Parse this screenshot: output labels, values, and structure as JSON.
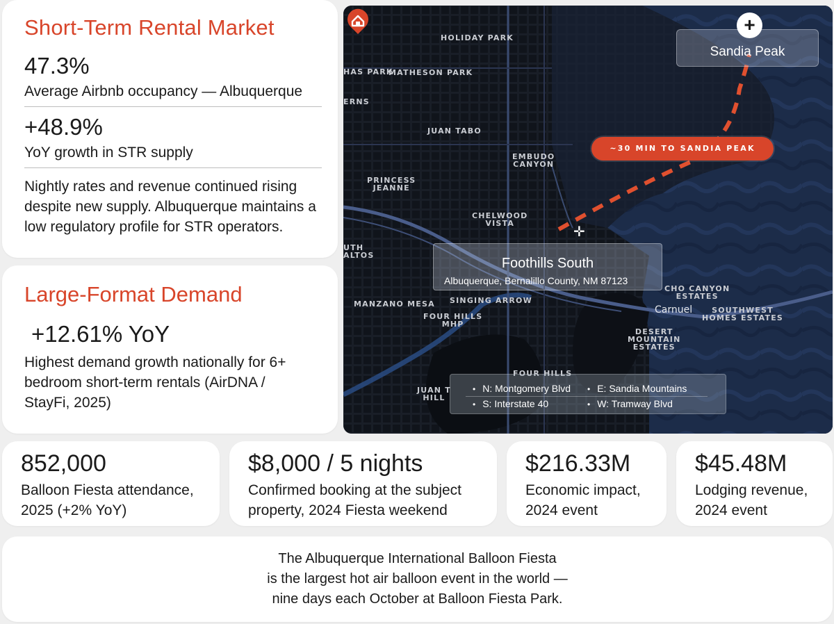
{
  "str_card": {
    "title": "Short-Term Rental Market",
    "occupancy_value": "47.3%",
    "occupancy_label": "Average Airbnb occupancy — Albuquerque",
    "supply_value": "+48.9%",
    "supply_label": "YoY growth in STR supply",
    "paragraph": "Nightly rates and revenue continued rising despite new supply. Albuquerque maintains a low regulatory profile for STR operators."
  },
  "large_card": {
    "title": "Large-Format Demand",
    "value": "+12.61% YoY",
    "paragraph": "Highest demand growth nationally for 6+ bedroom short-term rentals (AirDNA / StayFi, 2025)"
  },
  "map": {
    "neighborhoods": {
      "holiday_park": "HOLIDAY PARK",
      "thomas_park": "HAS PARK",
      "matheson_park": "MATHESON PARK",
      "ferns": "ERNS",
      "juan_tabo": "JUAN TABO",
      "embudo_canyon": "EMBUDO\nCANYON",
      "princess_jeanne": "PRINCESS\nJEANNE",
      "chelwood_vista": "CHELWOOD\nVISTA",
      "south_los_altos": "UTH\nALTOS",
      "manzano_mesa": "MANZANO MESA",
      "singing_arrow": "SINGING ARROW",
      "four_hills_mhp": "FOUR HILLS\nMHP",
      "echo_canyon": "CHO CANYON\nESTATES",
      "carnuel": "Carnuel",
      "southwest_homes": "SOUTHWEST\nHOMES ESTATES",
      "desert_mountain": "DESERT\nMOUNTAIN\nESTATES",
      "four_hills": "FOUR HILLS",
      "juan_tabo_hills": "JUAN T\nHILL"
    },
    "peak_label": "Sandia Peak",
    "drive_time": "~30 MIN TO SANDIA PEAK",
    "pin_title": "Foothills South",
    "pin_address": "Albuquerque, Bernalillo County, NM 87123",
    "bounds": {
      "north": "N: Montgomery Blvd",
      "east": "E: Sandia Mountains",
      "south": "S: Interstate 40",
      "west": "W: Tramway Blvd"
    },
    "colors": {
      "accent": "#d8452a",
      "land": "#151a22",
      "mountain": "#1b2b47",
      "road": "#4a5d8a"
    }
  },
  "stats": [
    {
      "value": "852,000",
      "desc": "Balloon Fiesta attendance, 2025 (+2% YoY)"
    },
    {
      "value": "$8,000 / 5 nights",
      "desc": "Confirmed booking at the subject property, 2024 Fiesta weekend"
    },
    {
      "value": "$216.33M",
      "desc": "Economic impact, 2024 event"
    },
    {
      "value": "$45.48M",
      "desc": "Lodging revenue, 2024 event"
    }
  ],
  "footer": {
    "line1": "The Albuquerque International Balloon Fiesta",
    "line2": "is the largest hot air balloon event in the world —",
    "line3": "nine days each October at Balloon Fiesta Park."
  }
}
